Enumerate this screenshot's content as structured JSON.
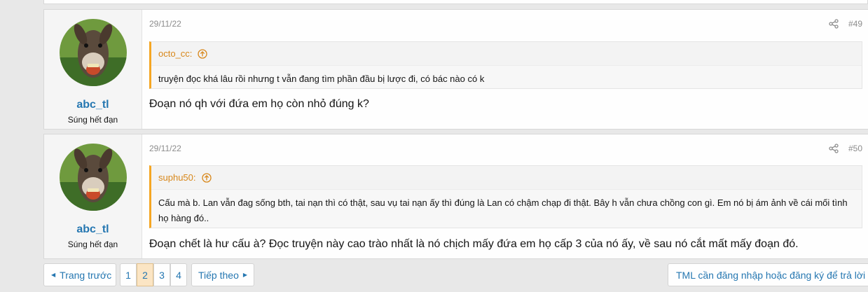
{
  "posts": [
    {
      "user": {
        "name": "abc_tl",
        "title": "Súng hết đạn",
        "avatar": "donkey-avatar"
      },
      "date": "29/11/22",
      "number": "#49",
      "quote": {
        "author": "octo_cc:",
        "text": "truyện đọc khá lâu rồi nhưng t vẫn đang tìm phần đầu bị lược đi, có bác nào có k"
      },
      "message": "Đoạn nó qh với đứa em họ còn nhỏ đúng k?"
    },
    {
      "user": {
        "name": "abc_tl",
        "title": "Súng hết đạn",
        "avatar": "donkey-avatar"
      },
      "date": "29/11/22",
      "number": "#50",
      "quote": {
        "author": "suphu50:",
        "text": "Cấu mà b. Lan vẫn đag sống bth, tai nạn thì có thật, sau vụ tai nạn ấy thì đúng là Lan có chậm chạp đi thật. Bây h vẫn chưa chồng con gì. Em nó bị ám ảnh về cái mối tình họ hàng đó.."
      },
      "message": "Đoạn chết là hư cấu à? Đọc truyện này cao trào nhất là nó chịch mấy đứa em họ cấp 3 của nó ấy, về sau nó cắt mất mấy đoạn đó."
    }
  ],
  "pagination": {
    "prev_label": "Trang trước",
    "next_label": "Tiếp theo",
    "pages": [
      "1",
      "2",
      "3",
      "4"
    ],
    "current_page": "2"
  },
  "login_prompt": "TML cần đăng nhập hoặc đăng ký để trả lời",
  "colors": {
    "link": "#2577b1",
    "quote_accent": "#f5a623",
    "current_page_bg": "#fbe5c4"
  }
}
